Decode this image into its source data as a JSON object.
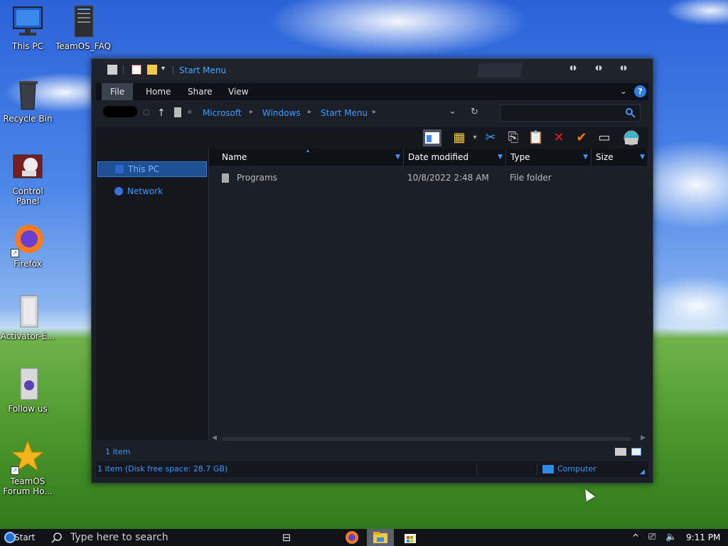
{
  "desktop": {
    "icons": [
      {
        "label": "This PC"
      },
      {
        "label": "TeamOS_FAQ"
      },
      {
        "label": "Recycle Bin"
      },
      {
        "label": "Control Panel"
      },
      {
        "label": "Firefox"
      },
      {
        "label": "Activator-E..."
      },
      {
        "label": "Follow us"
      },
      {
        "label": "TeamOS Forum Ho..."
      }
    ]
  },
  "window": {
    "title": "Start Menu",
    "ribbon_tabs": [
      "File",
      "Home",
      "Share",
      "View"
    ],
    "help_label": "?",
    "breadcrumbs": [
      "Microsoft",
      "Windows",
      "Start Menu"
    ],
    "columns": [
      "Name",
      "Date modified",
      "Type",
      "Size"
    ],
    "files": [
      {
        "name": "Programs",
        "date_modified": "10/8/2022 2:48 AM",
        "type": "File folder",
        "size": ""
      }
    ],
    "nav": {
      "this_pc": "This PC",
      "network": "Network"
    },
    "item_count": "1 item",
    "status_text": "1 item (Disk free space: 28.7 GB)",
    "status_location": "Computer"
  },
  "taskbar": {
    "start_label": "Start",
    "search_placeholder": "Type here to search",
    "time": "9:11 PM"
  },
  "colors": {
    "accent": "#3e9bff",
    "window_bg": "#1b1f27",
    "taskbar_bg": "#101215"
  }
}
